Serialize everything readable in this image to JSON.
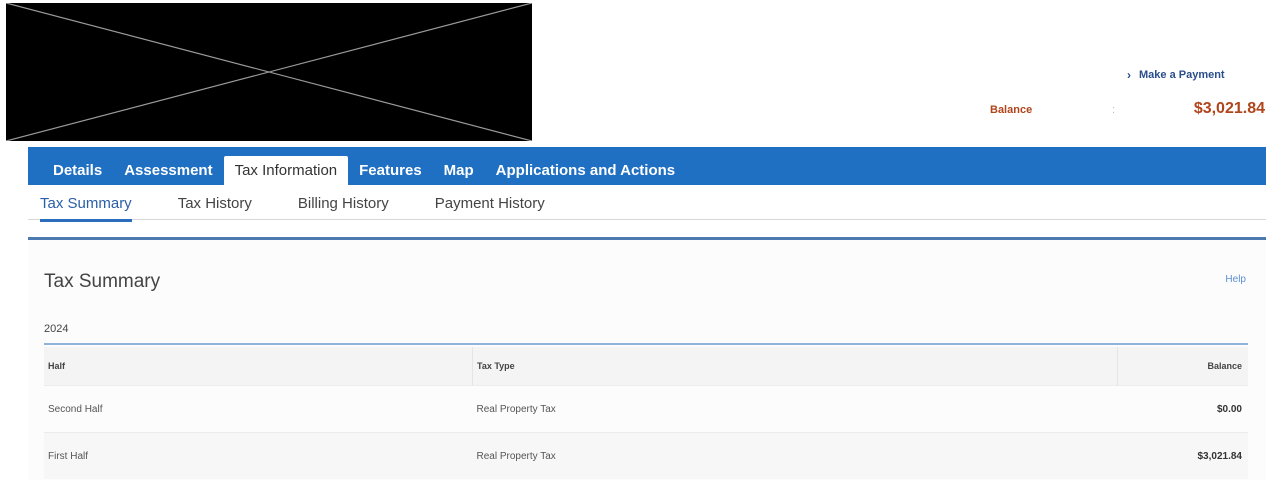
{
  "header": {
    "make_payment_label": "Make a Payment",
    "balance_label": "Balance",
    "balance_separator": ":",
    "balance_amount": "$3,021.84"
  },
  "tabs": [
    {
      "label": "Details"
    },
    {
      "label": "Assessment"
    },
    {
      "label": "Tax Information"
    },
    {
      "label": "Features"
    },
    {
      "label": "Map"
    },
    {
      "label": "Applications and Actions"
    }
  ],
  "subtabs": [
    {
      "label": "Tax Summary"
    },
    {
      "label": "Tax History"
    },
    {
      "label": "Billing History"
    },
    {
      "label": "Payment History"
    }
  ],
  "panel": {
    "title": "Tax Summary",
    "help_label": "Help",
    "year": "2024",
    "columns": [
      "Half",
      "Tax Type",
      "Balance"
    ],
    "rows": [
      {
        "half": "Second Half",
        "tax_type": "Real Property Tax",
        "balance": "$0.00"
      },
      {
        "half": "First Half",
        "tax_type": "Real Property Tax",
        "balance": "$3,021.84"
      }
    ]
  },
  "colors": {
    "tab_bar": "#1f6fc2",
    "balance_accent": "#b0441b",
    "link": "#2a4e8c"
  }
}
